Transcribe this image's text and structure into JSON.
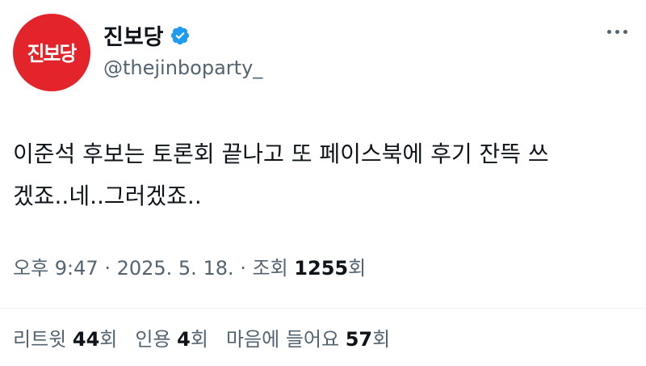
{
  "account": {
    "avatar_text": "진보당",
    "display_name": "진보당",
    "handle": "@thejinboparty_",
    "verified_icon": "verified-badge-icon",
    "avatar_color": "#e3242b",
    "verified_color": "#1d9bf0"
  },
  "more_icon": "more-options-icon",
  "tweet": {
    "text": "이준석 후보는 토론회 끝나고 또 페이스북에 후기 잔뜩 쓰\n겠죠..네..그러겠죠.."
  },
  "meta": {
    "time": "오후 9:47",
    "sep1": " · ",
    "date": "2025. 5. 18.",
    "sep2": " · ",
    "views_label": "조회 ",
    "views_count": "1255",
    "views_suffix": "회"
  },
  "stats": {
    "retweets": {
      "label": "리트윗 ",
      "count": "44",
      "suffix": "회"
    },
    "quotes": {
      "label": "인용 ",
      "count": "4",
      "suffix": "회"
    },
    "likes": {
      "label": "마음에 들어요 ",
      "count": "57",
      "suffix": "회"
    }
  }
}
